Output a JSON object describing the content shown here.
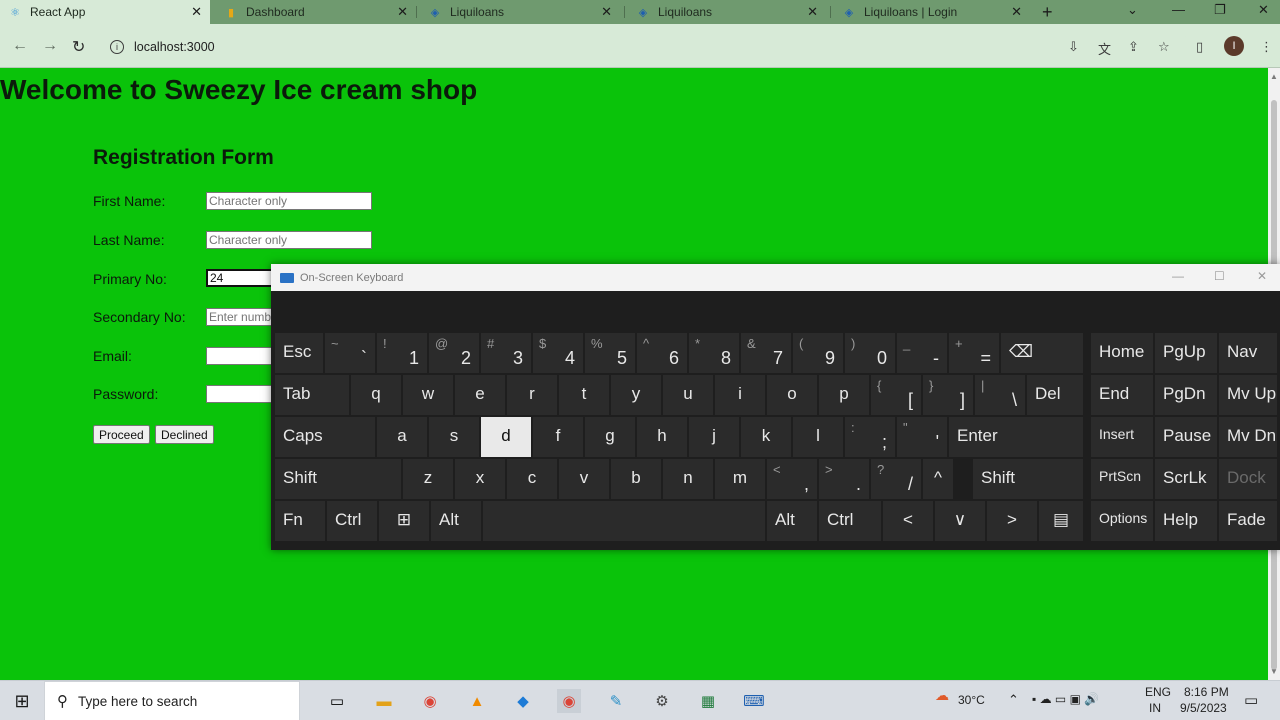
{
  "browser": {
    "tabs": [
      {
        "title": "React App",
        "active": true,
        "icon": "react-icon"
      },
      {
        "title": "Dashboard",
        "active": false,
        "icon": "bookmark-icon"
      },
      {
        "title": "Liquiloans",
        "active": false,
        "icon": "liquiloans-icon"
      },
      {
        "title": "Liquiloans",
        "active": false,
        "icon": "liquiloans-icon"
      },
      {
        "title": "Liquiloans | Login",
        "active": false,
        "icon": "liquiloans-icon"
      }
    ],
    "url": "localhost:3000",
    "profile_initial": "I"
  },
  "page": {
    "title": "Welcome to Sweezy Ice cream shop",
    "form_title": "Registration Form",
    "fields": [
      {
        "label": "First Name:",
        "placeholder": "Character only",
        "value": ""
      },
      {
        "label": "Last Name:",
        "placeholder": "Character only",
        "value": ""
      },
      {
        "label": "Primary No:",
        "placeholder": "",
        "value": "24"
      },
      {
        "label": "Secondary No:",
        "placeholder": "Enter numb",
        "value": ""
      },
      {
        "label": "Email:",
        "placeholder": "",
        "value": ""
      },
      {
        "label": "Password:",
        "placeholder": "",
        "value": ""
      }
    ],
    "buttons": {
      "proceed": "Proceed",
      "declined": "Declined"
    }
  },
  "osk": {
    "title": "On-Screen Keyboard",
    "row1": [
      {
        "main": "Esc"
      },
      {
        "shift": "~",
        "low": "`"
      },
      {
        "shift": "!",
        "low": "1"
      },
      {
        "shift": "@",
        "low": "2"
      },
      {
        "shift": "#",
        "low": "3"
      },
      {
        "shift": "$",
        "low": "4"
      },
      {
        "shift": "%",
        "low": "5"
      },
      {
        "shift": "^",
        "low": "6"
      },
      {
        "shift": "&",
        "low": "7"
      },
      {
        "shift": "(",
        "low": "9"
      },
      {
        "shift": ")",
        "low": "0"
      },
      {
        "shift": "_",
        "low": "-"
      },
      {
        "shift": "+",
        "low": "="
      },
      {
        "main": "⌫"
      }
    ],
    "row1_8": {
      "shift": "*",
      "low": "8"
    },
    "row2": [
      "Tab",
      "q",
      "w",
      "e",
      "r",
      "t",
      "y",
      "u",
      "i",
      "o",
      "p"
    ],
    "row2_sym": [
      {
        "shift": "{",
        "low": "["
      },
      {
        "shift": "}",
        "low": "]"
      },
      {
        "shift": "|",
        "low": "\\"
      }
    ],
    "row2_del": "Del",
    "row3": [
      "Caps",
      "a",
      "s",
      "d",
      "f",
      "g",
      "h",
      "j",
      "k",
      "l"
    ],
    "row3_sym": [
      {
        "shift": ":",
        "low": ";"
      },
      {
        "shift": "\"",
        "low": "'"
      }
    ],
    "row3_enter": "Enter",
    "row4": [
      "Shift",
      "z",
      "x",
      "c",
      "v",
      "b",
      "n",
      "m"
    ],
    "row4_sym": [
      {
        "shift": "<",
        "low": ","
      },
      {
        "shift": ">",
        "low": "."
      },
      {
        "shift": "?",
        "low": "/"
      }
    ],
    "row4_up": "^",
    "row4_shift2": "Shift",
    "row5": [
      "Fn",
      "Ctrl",
      "⊞",
      "Alt",
      "",
      "Alt",
      "Ctrl",
      "<",
      "∨",
      ">",
      "▤"
    ],
    "nav_keys": [
      [
        "Home",
        "PgUp",
        "Nav"
      ],
      [
        "End",
        "PgDn",
        "Mv Up"
      ],
      [
        "Insert",
        "Pause",
        "Mv Dn"
      ],
      [
        "PrtScn",
        "ScrLk",
        "Dock"
      ],
      [
        "Options",
        "Help",
        "Fade"
      ]
    ],
    "pressed_key": "d"
  },
  "taskbar": {
    "search_placeholder": "Type here to search",
    "weather": "30°C",
    "lang": "ENG",
    "region": "IN",
    "time": "8:16 PM",
    "date": "9/5/2023"
  }
}
